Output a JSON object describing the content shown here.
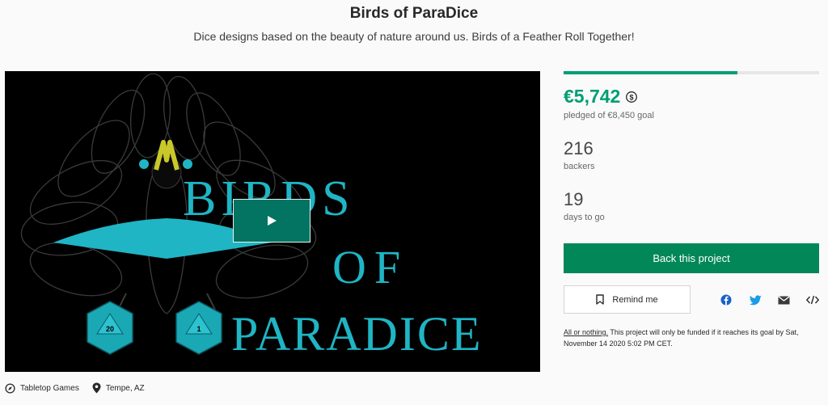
{
  "project": {
    "title": "Birds of ParaDice",
    "blurb": "Dice designs based on the beauty of nature around us. Birds of a Feather Roll Together!"
  },
  "video": {
    "logo_line1": "BIRDS",
    "logo_line2": "OF",
    "logo_line3": "PARADICE",
    "die_left": "20",
    "die_right": "1",
    "play_label": "Play video"
  },
  "meta": {
    "category": "Tabletop Games",
    "location": "Tempe, AZ"
  },
  "funding": {
    "progress_fraction": 0.68,
    "pledged": "€5,742",
    "goal_text": "pledged of €8,450 goal",
    "backers_count": "216",
    "backers_label": "backers",
    "days_count": "19",
    "days_label": "days to go"
  },
  "actions": {
    "back_label": "Back this project",
    "remind_label": "Remind me"
  },
  "share": {
    "icons": [
      "facebook-icon",
      "twitter-icon",
      "email-icon",
      "embed-icon"
    ]
  },
  "fine_print": {
    "link": "All or nothing.",
    "text": " This project will only be funded if it reaches its goal by Sat, November 14 2020 5:02 PM CET."
  },
  "colors": {
    "accent": "#009e74",
    "button": "#028858",
    "video_play": "#037362",
    "logo_teal": "#1fb5c4"
  }
}
